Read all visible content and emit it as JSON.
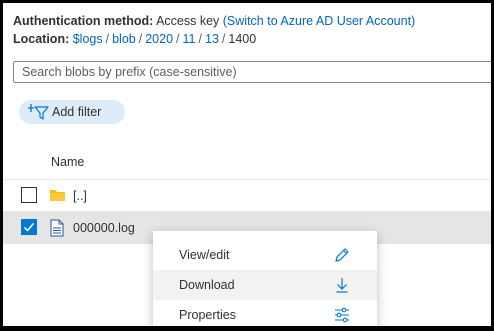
{
  "auth": {
    "label": "Authentication method:",
    "value": "Access key",
    "switch_link": "(Switch to Azure AD User Account)"
  },
  "location": {
    "label": "Location:",
    "crumbs": [
      "$logs",
      "blob",
      "2020",
      "11",
      "13"
    ],
    "current": "1400"
  },
  "search": {
    "placeholder": "Search blobs by prefix (case-sensitive)"
  },
  "filter": {
    "label": "Add filter"
  },
  "table": {
    "header_name": "Name",
    "rows": [
      {
        "name": "[..]",
        "type": "folder",
        "checked": false
      },
      {
        "name": "000000.log",
        "type": "file",
        "checked": true
      }
    ]
  },
  "context_menu": {
    "items": [
      {
        "label": "View/edit",
        "icon": "pencil-icon"
      },
      {
        "label": "Download",
        "icon": "download-arrow-icon"
      },
      {
        "label": "Properties",
        "icon": "sliders-icon"
      }
    ]
  },
  "colors": {
    "link": "#0067b8",
    "accent": "#0078d4",
    "folder": "#ffb900",
    "filter_bg": "#deecf9"
  }
}
